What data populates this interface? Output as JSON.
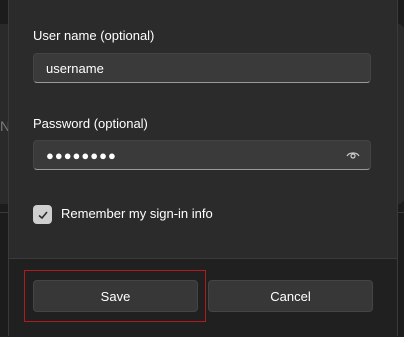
{
  "backdrop": {
    "partial_letter": "N"
  },
  "form": {
    "username": {
      "label": "User name (optional)",
      "value": "username"
    },
    "password": {
      "label": "Password (optional)",
      "value": "●●●●●●●●"
    },
    "remember": {
      "label": "Remember my sign-in info",
      "checked": true
    }
  },
  "footer": {
    "save_label": "Save",
    "cancel_label": "Cancel"
  },
  "colors": {
    "dialog_bg": "#2b2b2b",
    "footer_bg": "#202020",
    "highlight": "#b0191e"
  },
  "icons": {
    "reveal": "eye-icon",
    "check": "checkmark-icon"
  }
}
